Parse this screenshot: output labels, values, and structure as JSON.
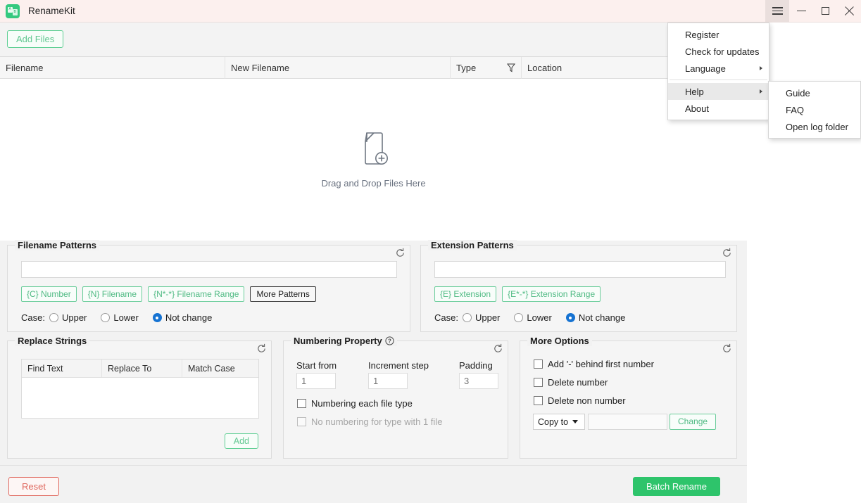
{
  "window": {
    "title": "RenameKit",
    "app_icon": "renamekit-logo-icon",
    "titlebar_bg": "#fcf0ee",
    "controls": {
      "menu": "menu-hamburger-icon",
      "minimize": "minimize-icon",
      "maximize": "maximize-icon",
      "close": "close-icon"
    }
  },
  "main_menu": {
    "items": [
      {
        "label": "Register",
        "submenu": false,
        "highlighted": false
      },
      {
        "label": "Check for updates",
        "submenu": false,
        "highlighted": false
      },
      {
        "label": "Language",
        "submenu": true,
        "highlighted": false
      },
      {
        "label": "Help",
        "submenu": true,
        "highlighted": true
      },
      {
        "label": "About",
        "submenu": false,
        "highlighted": false
      }
    ]
  },
  "help_submenu": {
    "items": [
      {
        "label": "Guide"
      },
      {
        "label": "FAQ"
      },
      {
        "label": "Open log folder"
      }
    ]
  },
  "toolbar": {
    "add_files_label": "Add Files"
  },
  "filelist": {
    "columns": [
      {
        "label": "Filename"
      },
      {
        "label": "New Filename"
      },
      {
        "label": "Type",
        "filter_icon": "funnel-filter-icon"
      },
      {
        "label": "Location"
      }
    ],
    "rows": [],
    "empty_state": {
      "icon": "file-add-icon",
      "label": "Drag and Drop Files Here"
    }
  },
  "filename_patterns": {
    "legend": "Filename Patterns",
    "refresh_icon": "refresh-icon",
    "input_value": "",
    "buttons": [
      {
        "label": "{C} Number",
        "style": "green"
      },
      {
        "label": "{N} Filename",
        "style": "green"
      },
      {
        "label": "{N*-*} Filename Range",
        "style": "green"
      },
      {
        "label": "More Patterns",
        "style": "plain"
      }
    ],
    "case_label": "Case:",
    "case_options": [
      {
        "label": "Upper",
        "selected": false
      },
      {
        "label": "Lower",
        "selected": false
      },
      {
        "label": "Not change",
        "selected": true
      }
    ]
  },
  "extension_patterns": {
    "legend": "Extension Patterns",
    "refresh_icon": "refresh-icon",
    "input_value": "",
    "buttons": [
      {
        "label": "{E} Extension",
        "style": "green"
      },
      {
        "label": "{E*-*} Extension Range",
        "style": "green"
      }
    ],
    "case_label": "Case:",
    "case_options": [
      {
        "label": "Upper",
        "selected": false
      },
      {
        "label": "Lower",
        "selected": false
      },
      {
        "label": "Not change",
        "selected": true
      }
    ]
  },
  "replace_strings": {
    "legend": "Replace Strings",
    "refresh_icon": "refresh-icon",
    "columns": [
      "Find Text",
      "Replace To",
      "Match Case"
    ],
    "rows": [],
    "add_label": "Add"
  },
  "numbering_property": {
    "legend": "Numbering Property",
    "help_icon": "question-mark-icon",
    "refresh_icon": "refresh-icon",
    "fields": [
      {
        "label": "Start from",
        "value": "1"
      },
      {
        "label": "Increment step",
        "value": "1"
      },
      {
        "label": "Padding",
        "value": "3"
      }
    ],
    "checkboxes": [
      {
        "label": "Numbering each file type",
        "checked": false,
        "disabled": false
      },
      {
        "label": "No numbering for type with 1 file",
        "checked": false,
        "disabled": true
      }
    ]
  },
  "more_options": {
    "legend": "More Options",
    "refresh_icon": "refresh-icon",
    "checkboxes": [
      {
        "label": "Add '-' behind first number",
        "checked": false
      },
      {
        "label": "Delete number",
        "checked": false
      },
      {
        "label": "Delete non number",
        "checked": false
      }
    ],
    "select_value": "Copy to",
    "path_value": "",
    "change_label": "Change"
  },
  "footer": {
    "reset_label": "Reset",
    "batch_rename_label": "Batch Rename",
    "accent_green": "#2ec46b",
    "accent_red": "#e0695f"
  }
}
